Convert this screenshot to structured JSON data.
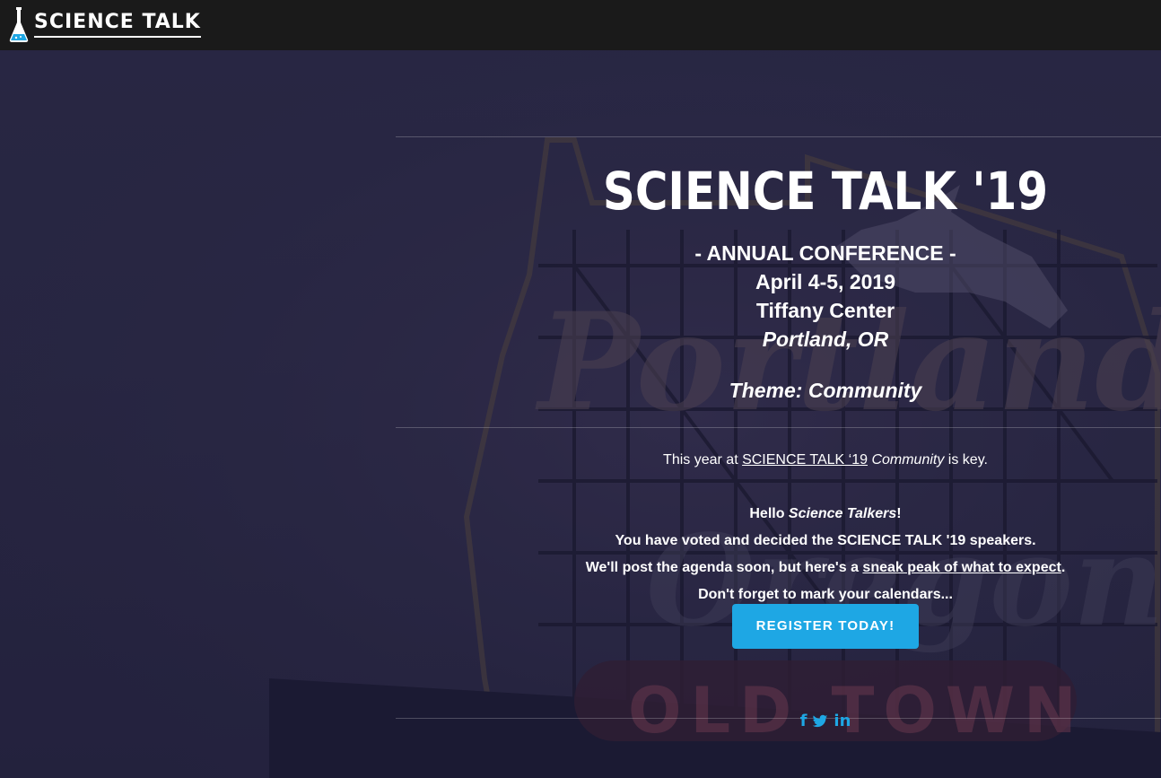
{
  "brand": {
    "name": "SCIENCE TALK",
    "logo_icon": "flask-icon"
  },
  "hero": {
    "title": "SCIENCE TALK '19",
    "conference_label": "- ANNUAL CONFERENCE -",
    "dates": "April 4-5, 2019",
    "venue": "Tiffany Center",
    "location": "Portland, OR",
    "theme": "Theme: Community",
    "intro": {
      "prefix": "This year at ",
      "link_text": "SCIENCE TALK ‘19",
      "emphasis": "Community",
      "suffix": " is key."
    },
    "hello": {
      "greeting_prefix": "Hello ",
      "greeting_emphasis": "Science Talkers",
      "greeting_suffix": "!",
      "line2": "You have voted and decided the SCIENCE TALK '19 speakers.",
      "line3_prefix": "We'll post the agenda soon, but here's a ",
      "line3_link": "sneak peak of what to expect",
      "line3_suffix": ".",
      "line4": "Don't forget to mark your calendars..."
    },
    "register_label": "REGISTER TODAY!",
    "background_sign": {
      "word1": "Portland",
      "word2": "Oregon",
      "word3": "OLD TOWN"
    }
  },
  "social": {
    "facebook": "f",
    "twitter": "🐦",
    "linkedin": "in"
  },
  "colors": {
    "topbar": "#1a1a1a",
    "accent": "#1ea7e4",
    "overlay": "#2a2944"
  }
}
